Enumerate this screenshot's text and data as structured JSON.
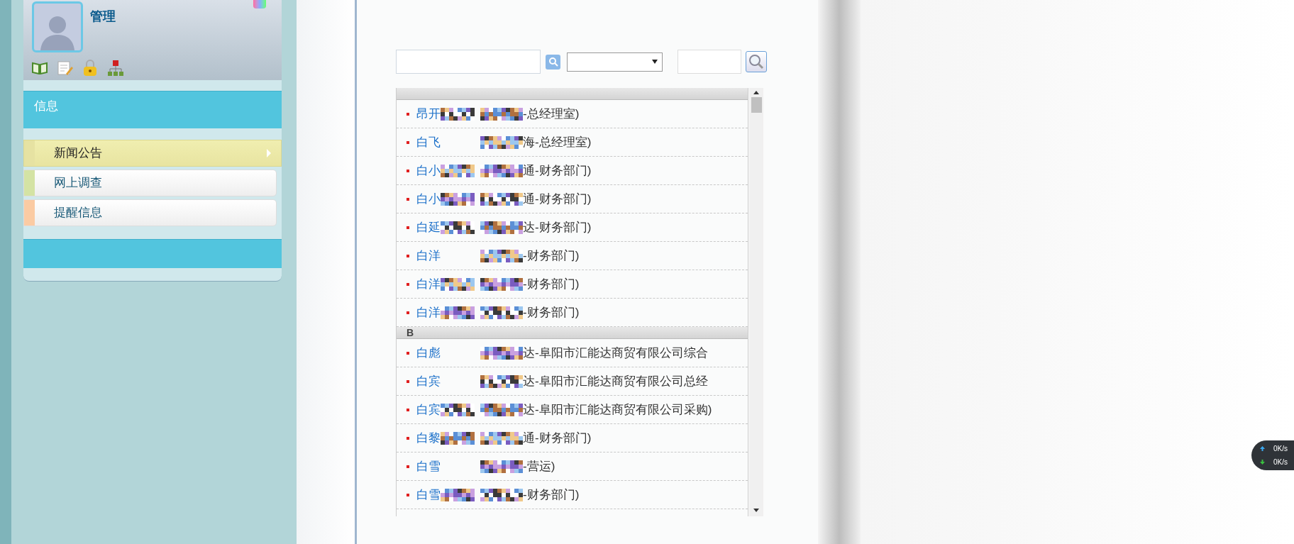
{
  "sidebar": {
    "user": {
      "name": "管理"
    },
    "section": {
      "title": "信息"
    },
    "menu": [
      {
        "label": "新闻公告",
        "selected": true,
        "color": "#e6e2a2"
      },
      {
        "label": "网上调查",
        "selected": false,
        "color": "#d4e3a4"
      },
      {
        "label": "提醒信息",
        "selected": false,
        "color": "#fbcba3"
      }
    ]
  },
  "contacts": {
    "groups": [
      {
        "rows": [
          {
            "name": "昂开",
            "masked_name": true,
            "detail": "-总经理室)"
          },
          {
            "name": "白飞",
            "masked_name": false,
            "detail": "海-总经理室)"
          },
          {
            "name": "白小",
            "masked_name": true,
            "detail": "通-财务部门)"
          },
          {
            "name": "白小",
            "masked_name": true,
            "detail": "通-财务部门)"
          },
          {
            "name": "白延",
            "masked_name": true,
            "detail": "达-财务部门)"
          },
          {
            "name": "白洋",
            "masked_name": false,
            "detail": "-财务部门)"
          },
          {
            "name": "白洋",
            "masked_name": true,
            "detail": "-财务部门)"
          },
          {
            "name": "白洋",
            "masked_name": true,
            "detail": "-财务部门)"
          }
        ]
      },
      {
        "header": "B",
        "rows": [
          {
            "name": "白彪",
            "masked_name": false,
            "detail": "达-阜阳市汇能达商贸有限公司综合"
          },
          {
            "name": "白宾",
            "masked_name": false,
            "detail": "达-阜阳市汇能达商贸有限公司总经"
          },
          {
            "name": "白宾",
            "masked_name": true,
            "detail": "达-阜阳市汇能达商贸有限公司采购)"
          },
          {
            "name": "白黎",
            "masked_name": true,
            "detail": "通-财务部门)"
          },
          {
            "name": "白雪",
            "masked_name": false,
            "detail": "-营运)"
          },
          {
            "name": "白雪",
            "masked_name": true,
            "detail": "-财务部门)"
          }
        ]
      }
    ]
  },
  "network_speed": {
    "upload": "0K/s",
    "download": "0K/s"
  }
}
